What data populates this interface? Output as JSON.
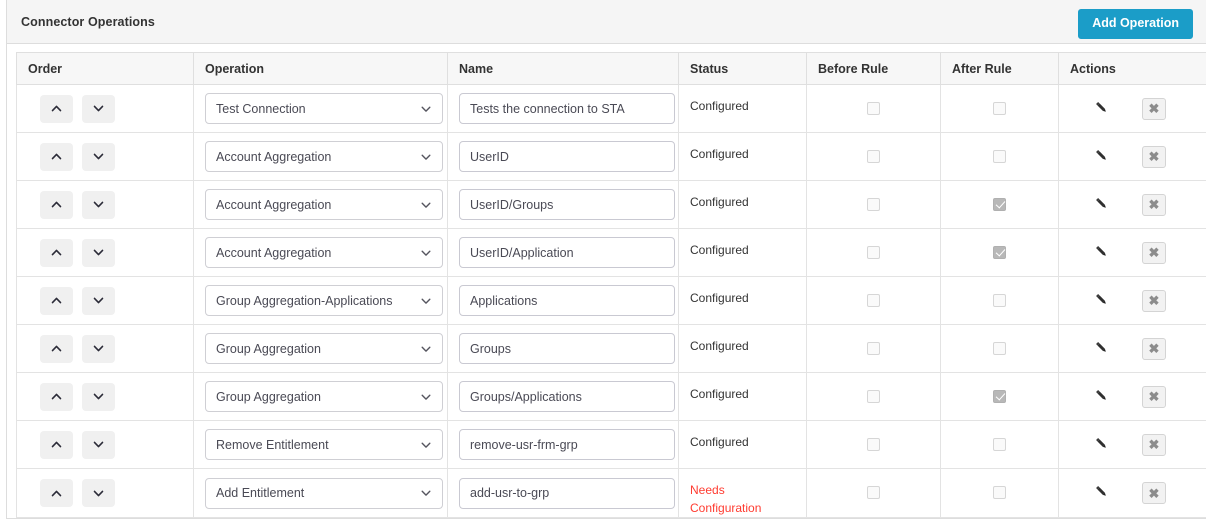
{
  "panel": {
    "title": "Connector Operations",
    "add_button_label": "Add Operation",
    "accent_color": "#1b9dc8",
    "header_background": "#f5f5f5",
    "error_color": "#ff3b30"
  },
  "table": {
    "columns": [
      {
        "key": "order",
        "label": "Order"
      },
      {
        "key": "op",
        "label": "Operation"
      },
      {
        "key": "name",
        "label": "Name"
      },
      {
        "key": "status",
        "label": "Status"
      },
      {
        "key": "before",
        "label": "Before Rule"
      },
      {
        "key": "after",
        "label": "After Rule"
      },
      {
        "key": "actions",
        "label": "Actions"
      }
    ],
    "icons": {
      "move_up": "chevron-up-icon",
      "move_down": "chevron-down-icon",
      "select_caret": "chevron-down-icon",
      "edit": "pencil-icon",
      "delete": "close-x-icon"
    },
    "delete_glyph": "✖",
    "rows": [
      {
        "operation": "Test Connection",
        "name": "Tests the connection to STA",
        "status": "Configured",
        "status_state": "configured",
        "before_rule": false,
        "after_rule": false
      },
      {
        "operation": "Account Aggregation",
        "name": "UserID",
        "status": "Configured",
        "status_state": "configured",
        "before_rule": false,
        "after_rule": false
      },
      {
        "operation": "Account Aggregation",
        "name": "UserID/Groups",
        "status": "Configured",
        "status_state": "configured",
        "before_rule": false,
        "after_rule": true
      },
      {
        "operation": "Account Aggregation",
        "name": "UserID/Application",
        "status": "Configured",
        "status_state": "configured",
        "before_rule": false,
        "after_rule": true
      },
      {
        "operation": "Group Aggregation-Applications",
        "name": "Applications",
        "status": "Configured",
        "status_state": "configured",
        "before_rule": false,
        "after_rule": false
      },
      {
        "operation": "Group Aggregation",
        "name": "Groups",
        "status": "Configured",
        "status_state": "configured",
        "before_rule": false,
        "after_rule": false
      },
      {
        "operation": "Group Aggregation",
        "name": "Groups/Applications",
        "status": "Configured",
        "status_state": "configured",
        "before_rule": false,
        "after_rule": true
      },
      {
        "operation": "Remove Entitlement",
        "name": "remove-usr-frm-grp",
        "status": "Configured",
        "status_state": "configured",
        "before_rule": false,
        "after_rule": false
      },
      {
        "operation": "Add Entitlement",
        "name": "add-usr-to-grp",
        "status": "Needs Configuration",
        "status_state": "needs-configuration",
        "before_rule": false,
        "after_rule": false
      }
    ]
  }
}
